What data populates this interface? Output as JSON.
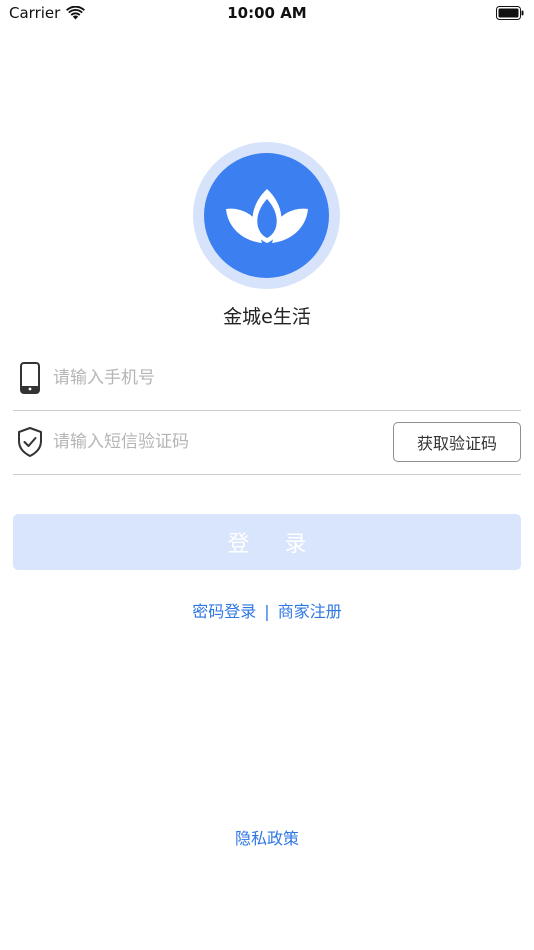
{
  "status_bar": {
    "carrier": "Carrier",
    "time": "10:00 AM",
    "wifi_icon": "wifi-icon",
    "battery_icon": "battery-icon"
  },
  "app": {
    "name": "金城e生活",
    "logo_icon": "lotus-logo-icon"
  },
  "form": {
    "phone": {
      "icon": "phone-icon",
      "placeholder": "请输入手机号",
      "value": ""
    },
    "code": {
      "icon": "shield-check-icon",
      "placeholder": "请输入短信验证码",
      "value": "",
      "get_code_label": "获取验证码"
    },
    "login_label": "登 录"
  },
  "links": {
    "password_login": "密码登录",
    "separator": "|",
    "merchant_register": "商家注册"
  },
  "footer": {
    "privacy_label": "隐私政策"
  },
  "colors": {
    "accent": "#3b7ff0",
    "logo_ring": "#d6e3fb",
    "login_disabled": "#d9e5fc",
    "link": "#2f77e3"
  }
}
